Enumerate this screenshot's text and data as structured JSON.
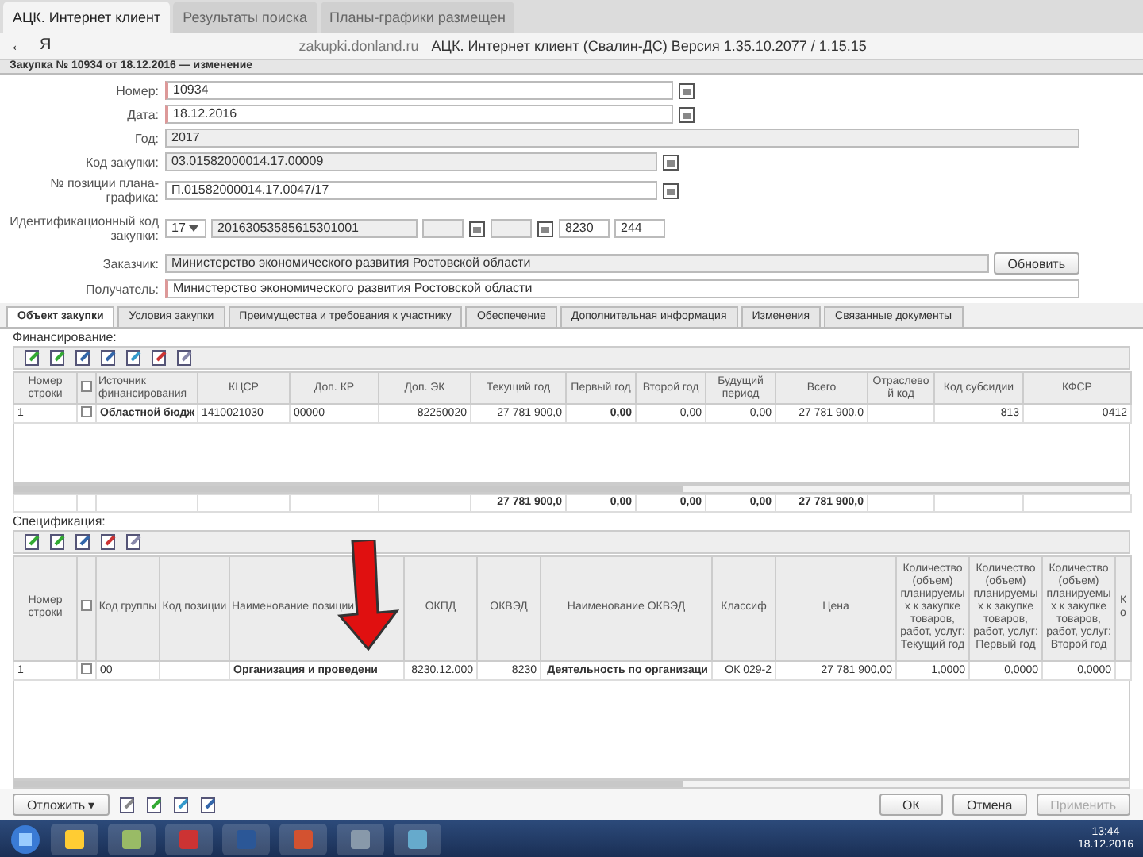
{
  "browser": {
    "tabs": [
      {
        "label": "АЦК. Интернет клиент",
        "selected": true
      },
      {
        "label": "Результаты поиска",
        "selected": false
      },
      {
        "label": "Планы-графики размещен",
        "selected": false
      }
    ],
    "back": "←",
    "logo": "Я",
    "address": "zakupki.donland.ru",
    "page_title": "АЦК. Интернет клиент (Свалин-ДС)  Версия 1.35.10.2077 / 1.15.15"
  },
  "window": {
    "title": "Закупка № 10934 от 18.12.2016 — изменение"
  },
  "form": {
    "number": {
      "label": "Номер:",
      "value": "10934"
    },
    "date": {
      "label": "Дата:",
      "value": "18.12.2016"
    },
    "year": {
      "label": "Год:",
      "value": "2017"
    },
    "purchase_code": {
      "label": "Код закупки:",
      "value": "03.01582000014.17.00009"
    },
    "plan_position": {
      "label": "№ позиции плана-графика:",
      "value": "П.01582000014.17.0047/17"
    },
    "ident_code": {
      "label": "Идентификационный код закупки:",
      "parts": [
        {
          "kind": "select",
          "value": "17"
        },
        {
          "kind": "text",
          "value": "20163053585615301001"
        },
        {
          "kind": "date"
        },
        {
          "kind": "date"
        },
        {
          "kind": "lookup",
          "value": "8230"
        },
        {
          "kind": "lookup",
          "value": "244"
        }
      ]
    },
    "customer": {
      "label": "Заказчик:",
      "value": "Министерство экономического развития Ростовской области",
      "button": "Обновить"
    },
    "recipient": {
      "label": "Получатель:",
      "value": "Министерство экономического развития Ростовской области"
    }
  },
  "tabs": [
    {
      "label": "Объект закупки",
      "selected": true
    },
    {
      "label": "Условия закупки",
      "selected": false
    },
    {
      "label": "Преимущества и требования к участнику",
      "selected": false
    },
    {
      "label": "Обеспечение",
      "selected": false
    },
    {
      "label": "Дополнительная информация",
      "selected": false
    },
    {
      "label": "Изменения",
      "selected": false
    },
    {
      "label": "Связанные документы",
      "selected": false
    }
  ],
  "financing": {
    "title": "Финансирование:",
    "select_all": {
      "checked": false
    },
    "columns": [
      "Номер строки",
      "Источник финансирования",
      "КЦСР",
      "Доп. КР",
      "Доп. ЭК",
      "Текущий год",
      "Первый год",
      "Второй год",
      "Будущий период",
      "Всего",
      "Отраслевой код",
      "Код субсидии",
      "КФСР"
    ],
    "rows": [
      {
        "checked": false,
        "cells": [
          "1",
          "Областной бюдж",
          "1410021030",
          "00000",
          "82250020",
          "27 781 900,0",
          "0,00",
          "0,00",
          "0,00",
          "27 781 900,0",
          null,
          "813",
          "0412"
        ]
      }
    ],
    "totals": [
      "27 781 900,0",
      "0,00",
      "0,00",
      "0,00",
      "27 781 900,0"
    ]
  },
  "specification": {
    "title": "Спецификация:",
    "select_all": {
      "checked": false
    },
    "columns": [
      "Номер строки",
      "Код группы",
      "Код позиции",
      "Наименование позиции",
      "ОКПД",
      "ОКВЭД",
      "Наименование ОКВЭД",
      "Классиф",
      "Цена",
      "Количество (объем) планируемых к закупке товаров, работ, услуг: Текущий год",
      "Количество (объем) планируемых к закупке товаров, работ, услуг: Первый год",
      "Количество (объем) планируемых к закупке товаров, работ, услуг: Второй год",
      "Ко"
    ],
    "rows": [
      {
        "checked": false,
        "cells": [
          "1",
          "00",
          null,
          "Организация и проведени",
          "8230.12.000",
          "8230",
          "Деятельность по организаци",
          "ОК 029-2",
          "27 781 900,00",
          "1,0000",
          "0,0000",
          "0,0000",
          null
        ]
      }
    ]
  },
  "footer": {
    "menu": "Отложить",
    "menu_caret": "▾",
    "buttons": [
      {
        "label": "ОК",
        "disabled": false
      },
      {
        "label": "Отмена",
        "disabled": false
      },
      {
        "label": "Применить",
        "disabled": true
      }
    ]
  },
  "taskbar": {
    "time": "13:44",
    "date": "18.12.2016"
  }
}
